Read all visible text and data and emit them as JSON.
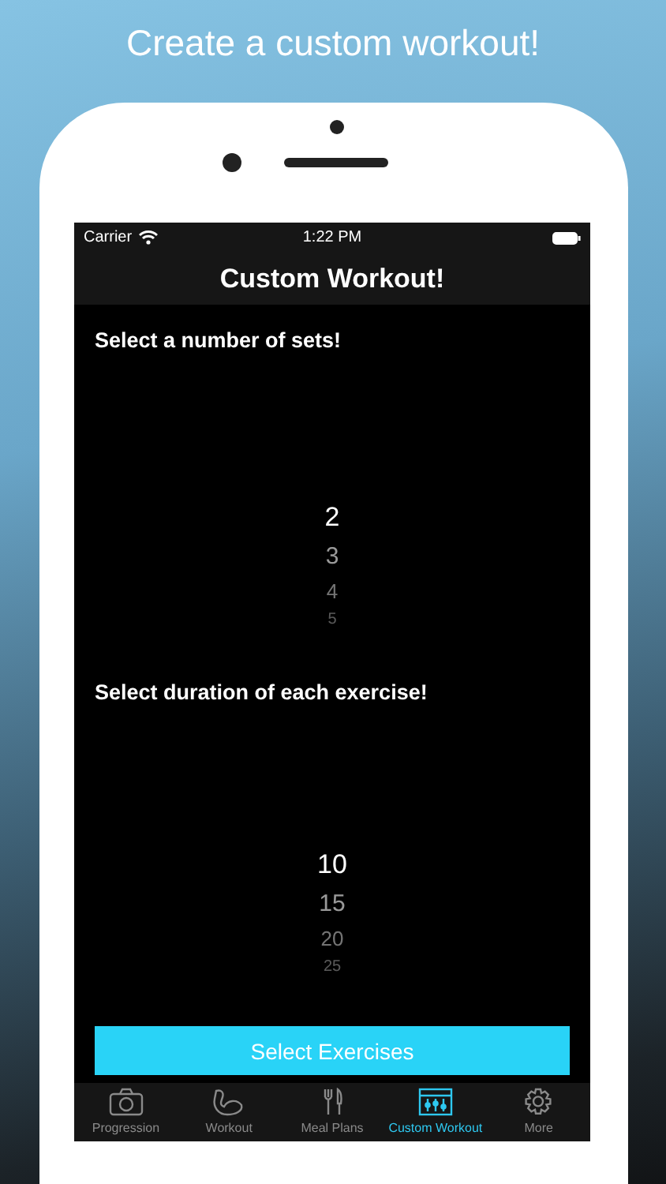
{
  "headline": "Create a custom workout!",
  "status_bar": {
    "carrier": "Carrier",
    "time": "1:22 PM"
  },
  "nav_title": "Custom Workout!",
  "sections": [
    {
      "label": "Select a number of sets!",
      "options": [
        {
          "label": "2",
          "selected": true
        },
        {
          "label": "3",
          "selected": false
        },
        {
          "label": "4",
          "selected": false
        },
        {
          "label": "5",
          "selected": false
        }
      ]
    },
    {
      "label": "Select duration of each exercise!",
      "options": [
        {
          "label": "10",
          "selected": true
        },
        {
          "label": "15",
          "selected": false
        },
        {
          "label": "20",
          "selected": false
        },
        {
          "label": "25",
          "selected": false
        }
      ]
    }
  ],
  "button": "Select Exercises",
  "tabs": [
    {
      "label": "Progression",
      "selected": false
    },
    {
      "label": "Workout",
      "selected": false
    },
    {
      "label": "Meal Plans",
      "selected": false
    },
    {
      "label": "Custom Workout",
      "selected": true
    },
    {
      "label": "More",
      "selected": false
    }
  ]
}
